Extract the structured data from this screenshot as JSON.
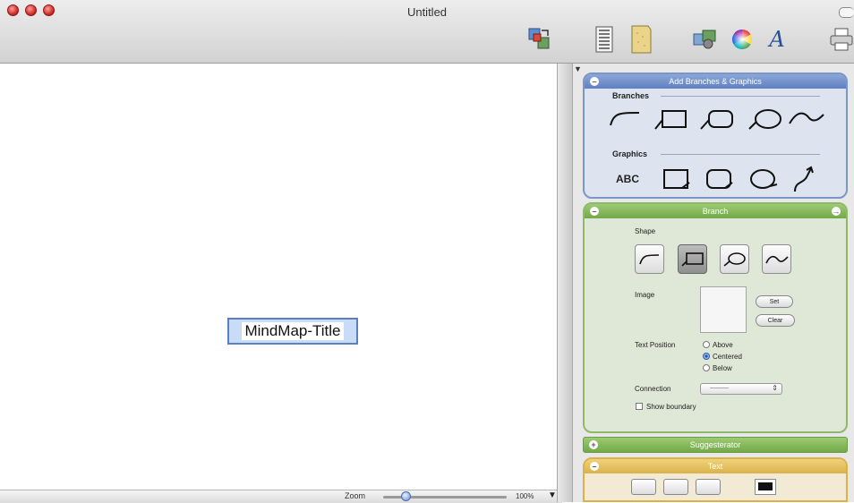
{
  "window": {
    "title": "Untitled"
  },
  "canvas": {
    "root_node_text": "MindMap-Title"
  },
  "statusbar": {
    "zoom_label": "Zoom",
    "zoom_value": "100%",
    "zoom_fraction": 0.18
  },
  "inspector": {
    "add_panel": {
      "header": "Add Branches & Graphics",
      "branches_label": "Branches",
      "graphics_label": "Graphics",
      "graphics_text_tool": "ABC"
    },
    "branch_panel": {
      "header": "Branch",
      "shape_label": "Shape",
      "image_label": "Image",
      "set_button": "Set",
      "clear_button": "Clear",
      "text_position_label": "Text Position",
      "positions": [
        "Above",
        "Centered",
        "Below"
      ],
      "selected_position": "Centered",
      "connection_label": "Connection",
      "connection_value": "———",
      "show_boundary_label": "Show boundary"
    },
    "suggesterator_header": "Suggesterator",
    "text_header": "Text"
  },
  "colors": {
    "accent_blue": "#5f80c2",
    "accent_green": "#73a847",
    "accent_yellow": "#d9b24a"
  }
}
